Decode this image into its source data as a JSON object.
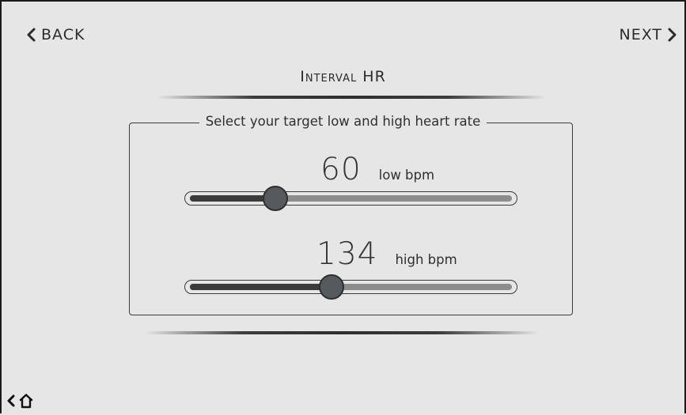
{
  "header": {
    "back_label": "BACK",
    "next_label": "NEXT",
    "title": "Interval HR"
  },
  "panel": {
    "legend": "Select your target low and high heart rate"
  },
  "low": {
    "value": "60",
    "unit": "low bpm",
    "slider_fraction": 0.265
  },
  "high": {
    "value": "134",
    "unit": "high bpm",
    "slider_fraction": 0.44
  },
  "footer": {
    "back_icon": "chevron-left-icon",
    "home_icon": "home-icon"
  },
  "colors": {
    "background": "#e6e6e6",
    "track_fill": "#3b3b3b",
    "track_rest": "#8d8d8d",
    "thumb": "#555a5e"
  }
}
